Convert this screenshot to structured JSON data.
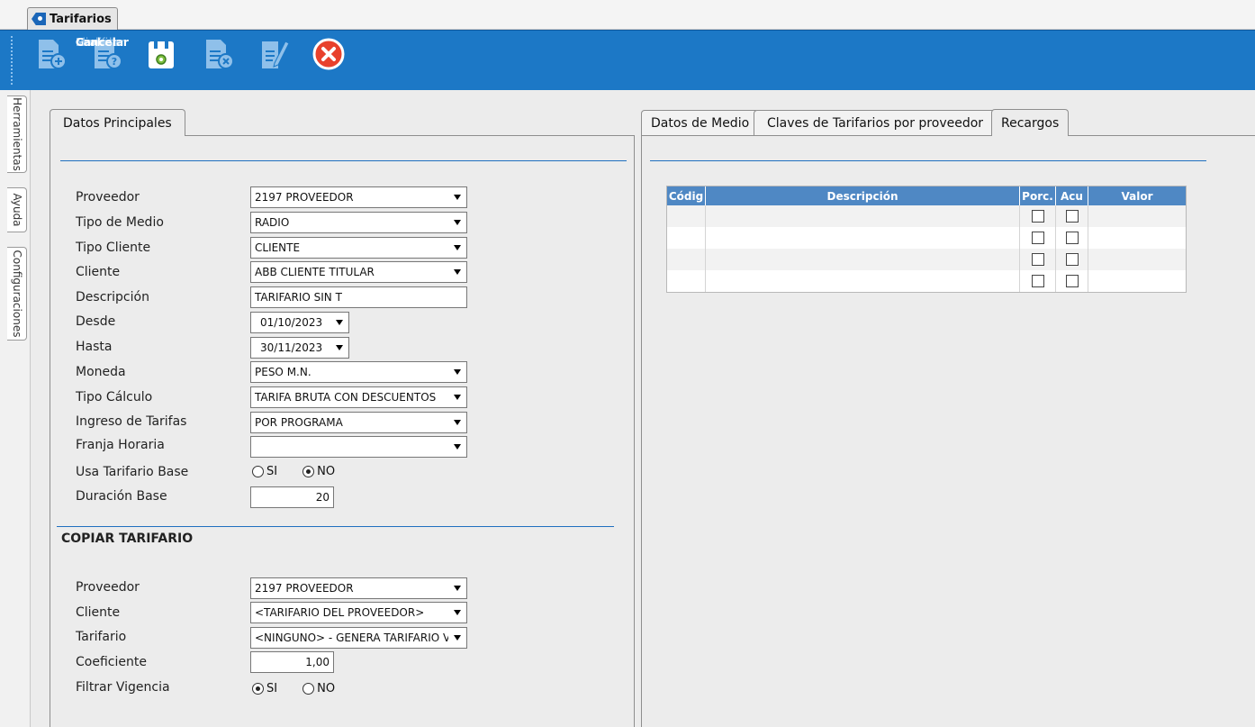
{
  "window_tab": {
    "title": "Tarifarios"
  },
  "toolbar": {
    "nuevo": "Nuevo",
    "consulta": "Consulta",
    "grabar": "Grabar",
    "eliminar": "Eliminar",
    "modificar": "Modificar",
    "cancelar": "Cancelar"
  },
  "side_tabs": [
    "Herramientas",
    "Ayuda",
    "Configuraciones"
  ],
  "left_panel": {
    "tab": "Datos Principales",
    "labels": {
      "proveedor": "Proveedor",
      "tipo_medio": "Tipo de Medio",
      "tipo_cliente": "Tipo Cliente",
      "cliente": "Cliente",
      "descripcion": "Descripción",
      "desde": "Desde",
      "hasta": "Hasta",
      "moneda": "Moneda",
      "tipo_calculo": "Tipo Cálculo",
      "ingreso_tarifas": "Ingreso de Tarifas",
      "franja_horaria": "Franja Horaria",
      "usa_tarifario_base": "Usa Tarifario Base",
      "duracion_base": "Duración Base"
    },
    "values": {
      "proveedor": "2197 PROVEEDOR",
      "tipo_medio": "RADIO",
      "tipo_cliente": "CLIENTE",
      "cliente": "ABB CLIENTE TITULAR",
      "descripcion": "TARIFARIO SIN T",
      "desde": "01/10/2023",
      "hasta": "30/11/2023",
      "moneda": "PESO M.N.",
      "tipo_calculo": "TARIFA BRUTA CON DESCUENTOS",
      "ingreso_tarifas": "POR PROGRAMA",
      "franja_horaria": "",
      "duracion_base": "20"
    },
    "usa_tarifario_base": {
      "si": "SI",
      "no": "NO",
      "selected": "NO"
    },
    "copy_section": {
      "title": "COPIAR TARIFARIO",
      "labels": {
        "proveedor": "Proveedor",
        "cliente": "Cliente",
        "tarifario": "Tarifario",
        "coeficiente": "Coeficiente",
        "filtrar_vigencia": "Filtrar Vigencia"
      },
      "values": {
        "proveedor": "2197 PROVEEDOR",
        "cliente": "<TARIFARIO DEL PROVEEDOR>",
        "tarifario": "<NINGUNO> - GENERA TARIFARIO VACI",
        "coeficiente": "1,00"
      },
      "filtrar_vigencia": {
        "si": "SI",
        "no": "NO",
        "selected": "SI"
      }
    }
  },
  "right_panel": {
    "tabs": [
      "Datos de Medio",
      "Claves de Tarifarios por proveedor",
      "Recargos"
    ],
    "active_tab": "Recargos",
    "grid": {
      "columns": [
        "Códig",
        "Descripción",
        "Porc.",
        "Acu",
        "Valor"
      ],
      "row_count": 4
    }
  },
  "colors": {
    "toolbar": "#1c78c6",
    "accent_rule": "#1f6fbf",
    "grid_header": "#4f88c4"
  }
}
